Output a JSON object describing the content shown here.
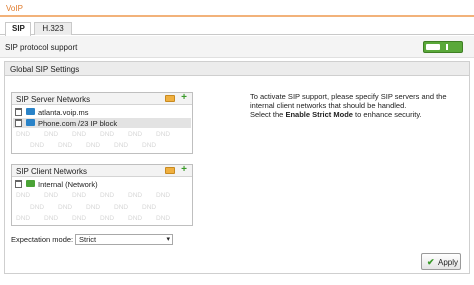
{
  "window": {
    "title": "VoIP"
  },
  "tabs": [
    {
      "label": "SIP",
      "active": true
    },
    {
      "label": "H.323",
      "active": false
    }
  ],
  "sip_support": {
    "label": "SIP protocol support",
    "enabled": true
  },
  "global": {
    "title": "Global SIP Settings",
    "server_networks": {
      "title": "SIP Server Networks",
      "items": [
        {
          "label": "atlanta.voip.ms",
          "icon": "server-network-icon"
        },
        {
          "label": "Phone.com /23 IP block",
          "icon": "server-network-icon"
        }
      ],
      "watermark": "DND"
    },
    "client_networks": {
      "title": "SIP Client Networks",
      "items": [
        {
          "label": "Internal (Network)",
          "icon": "internal-network-icon"
        }
      ],
      "watermark": "DND"
    },
    "help": {
      "line1": "To activate SIP support, please specify SIP servers and the",
      "line2": "internal client networks that should be handled.",
      "line3_prefix": "Select the ",
      "line3_bold": "Enable Strict Mode",
      "line3_suffix": " to enhance security."
    },
    "expectation": {
      "label": "Expectation mode:",
      "value": "Strict"
    }
  },
  "footer": {
    "apply_label": "Apply"
  },
  "colors": {
    "accent": "#e07b2c",
    "toggle_on": "#5aa83a"
  }
}
